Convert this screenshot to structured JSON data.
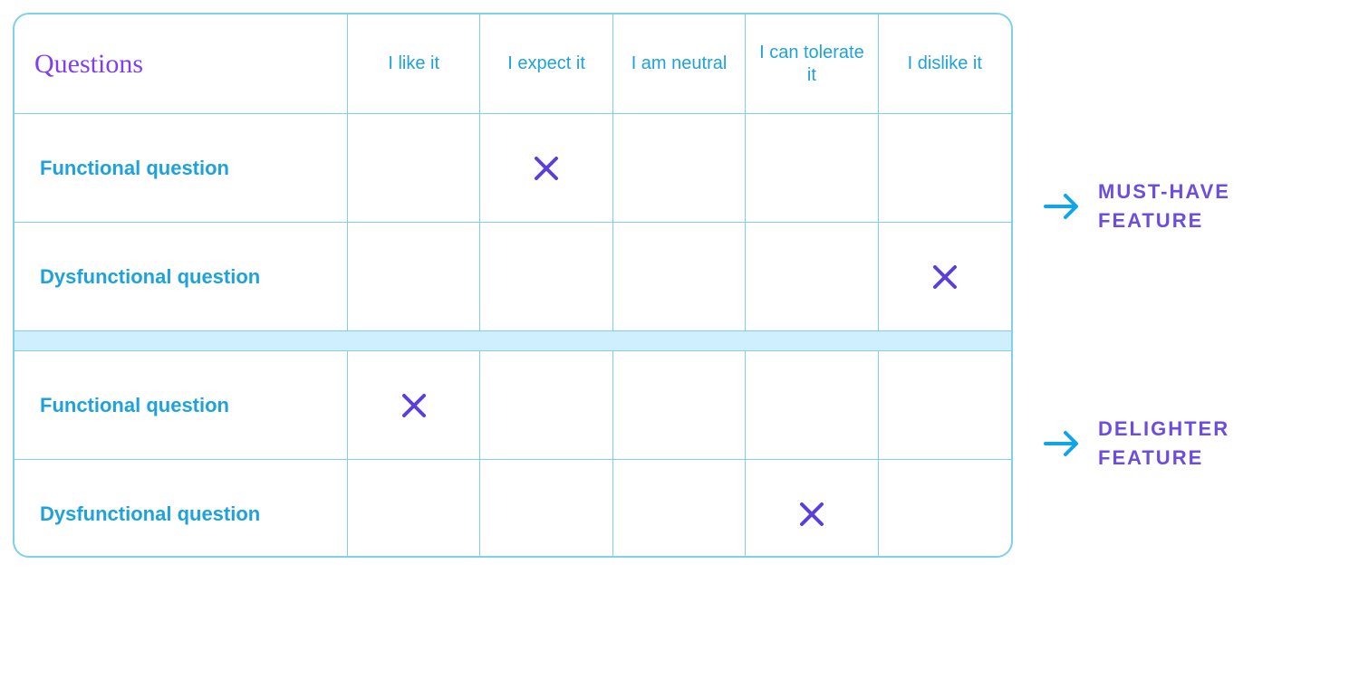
{
  "table": {
    "title": "Questions",
    "columns": [
      "I like it",
      "I expect it",
      "I am neutral",
      "I can tolerate it",
      "I dislike it"
    ],
    "rows": [
      {
        "label": "Functional question",
        "mark_col": 1
      },
      {
        "label": "Dysfunctional question",
        "mark_col": 4
      },
      {
        "label": "Functional question",
        "mark_col": 0
      },
      {
        "label": "Dysfunctional question",
        "mark_col": 3
      }
    ]
  },
  "annotations": [
    {
      "label": "MUST-HAVE\nFEATURE"
    },
    {
      "label": "DELIGHTER\nFEATURE"
    }
  ],
  "colors": {
    "border": "#7fd1e6",
    "header_text": "#1ea2db",
    "x_mark": "#5b3fd8",
    "title": "#7e3ff2",
    "separator_band": "#cfefff",
    "arrow": "#0ea5e9",
    "annotation_text": "#6d4de0"
  },
  "icons": {
    "x_mark": "x-icon",
    "arrow": "arrow-right-icon"
  }
}
